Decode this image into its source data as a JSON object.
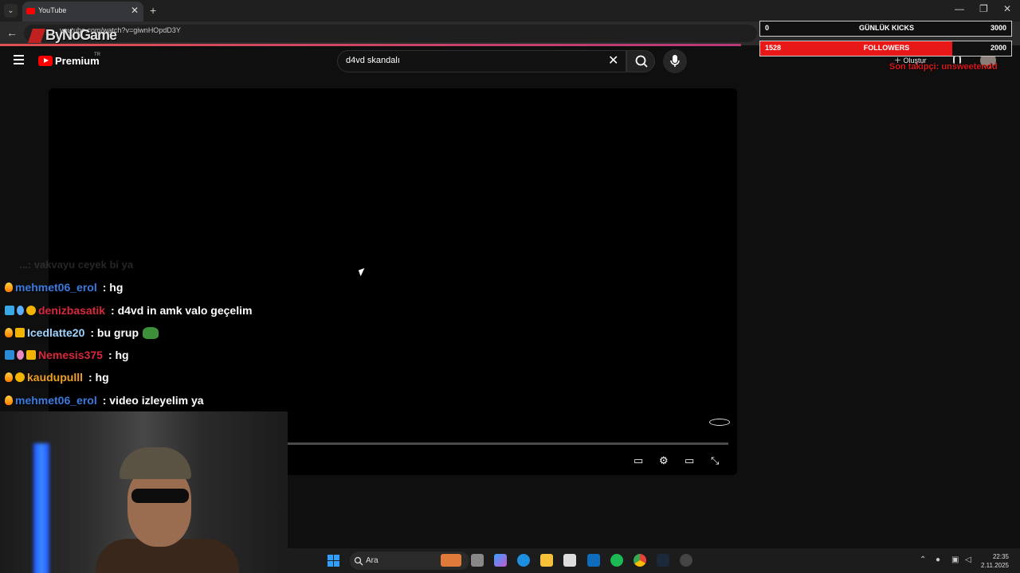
{
  "browser": {
    "tab_title": "YouTube",
    "url": "youtube.com/watch?v=giwnHOpdD3Y"
  },
  "watermark": "ByNoGame",
  "youtube": {
    "logo_text": "Premium",
    "region": "TR",
    "search_value": "d4vd skandalı",
    "create_label": "Oluştur"
  },
  "overlay": {
    "kicks": {
      "label": "GÜNLÜK KICKS",
      "current": "0",
      "goal": "3000"
    },
    "followers": {
      "label": "FOLLOWERS",
      "current": "1528",
      "goal": "2000",
      "progress": 0.764
    },
    "last_follower": "Son takipçi: unsweetendd"
  },
  "chat": {
    "faded_line": "...: vakvayu ceyek bi ya",
    "messages": [
      {
        "user": "mehmet06_erol",
        "text": ": hg",
        "color": "#3a7be0"
      },
      {
        "user": "denizbasatik",
        "text": ": d4vd in amk valo geçelim",
        "color": "#d8283c"
      },
      {
        "user": "Icedlatte20",
        "text": ": bu grup",
        "color": "#9fd4ff"
      },
      {
        "user": "Nemesis375",
        "text": ": hg",
        "color": "#d8283c"
      },
      {
        "user": "kaudupulll",
        "text": ": hg",
        "color": "#f0a020"
      },
      {
        "user": "mehmet06_erol",
        "text": ": video izleyelim ya",
        "color": "#3a7be0"
      }
    ]
  },
  "taskbar": {
    "search_label": "Ara",
    "time": "22:35",
    "date": "2.11.2025"
  },
  "colors": {
    "youtube_red": "#ff0000",
    "follower_bar": "#e81818",
    "taskbar_accent": "#2f9fff"
  }
}
